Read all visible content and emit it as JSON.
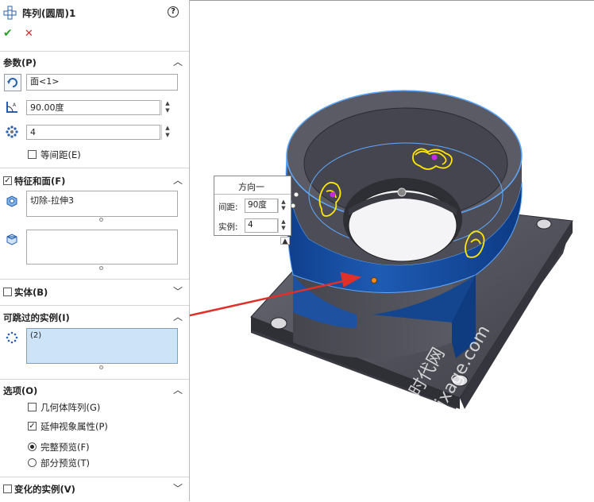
{
  "header": {
    "title": "阵列(圆周)1",
    "help": "?"
  },
  "actions": {
    "ok": "✔",
    "cancel": "✕"
  },
  "params": {
    "title": "参数(P)",
    "axis_value": "面<1>",
    "angle_value": "90.00度",
    "count_value": "4",
    "equal_spacing_label": "等间距(E)"
  },
  "features": {
    "title": "特征和面(F)",
    "feature_list": "切除-拉伸3",
    "faces_list": ""
  },
  "bodies": {
    "title": "实体(B)"
  },
  "skip": {
    "title": "可跳过的实例(I)",
    "value": "(2)"
  },
  "options": {
    "title": "选项(O)",
    "geometry_pattern": "几何体阵列(G)",
    "propagate_visual": "延伸视象属性(P)",
    "full_preview": "完整预览(F)",
    "partial_preview": "部分预览(T)"
  },
  "varied": {
    "title": "变化的实例(V)"
  },
  "callout": {
    "title": "方向一",
    "spacing_label": "间距:",
    "spacing_value": "90度",
    "instances_label": "实例:",
    "instances_value": "4"
  },
  "watermark": {
    "line1": "机械时代网",
    "line2": "www.jxage.com"
  },
  "colors": {
    "accent_blue": "#1f6fd1",
    "model_gray": "#5c5c66",
    "face_blue": "#1a52a8",
    "arrow_red": "#e0302a"
  }
}
